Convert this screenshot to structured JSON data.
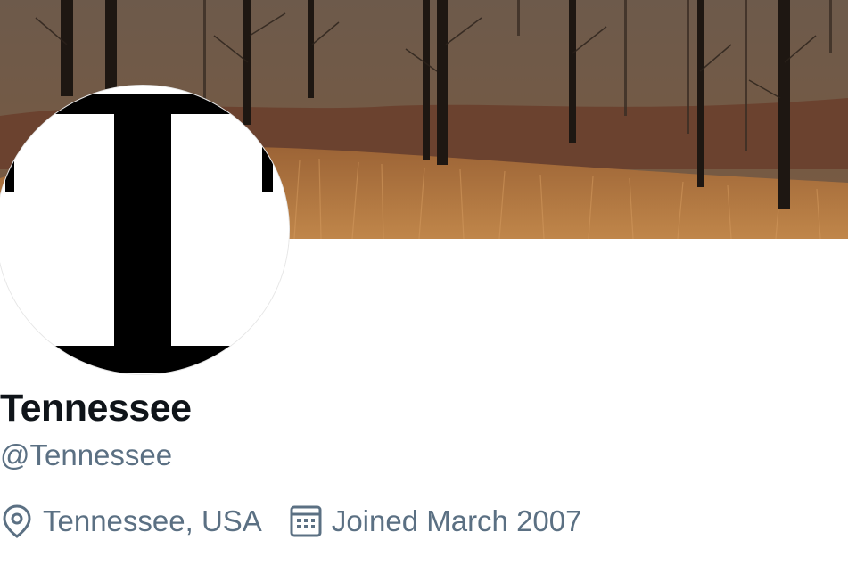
{
  "profile": {
    "display_name": "Tennessee",
    "handle": "@Tennessee",
    "location": "Tennessee, USA",
    "joined": "Joined March 2007",
    "avatar_letter": "T"
  },
  "icons": {
    "location": "map-pin-icon",
    "joined": "calendar-icon"
  },
  "colors": {
    "name_text": "#0f1419",
    "secondary_text": "#5b7083",
    "background": "#ffffff"
  }
}
